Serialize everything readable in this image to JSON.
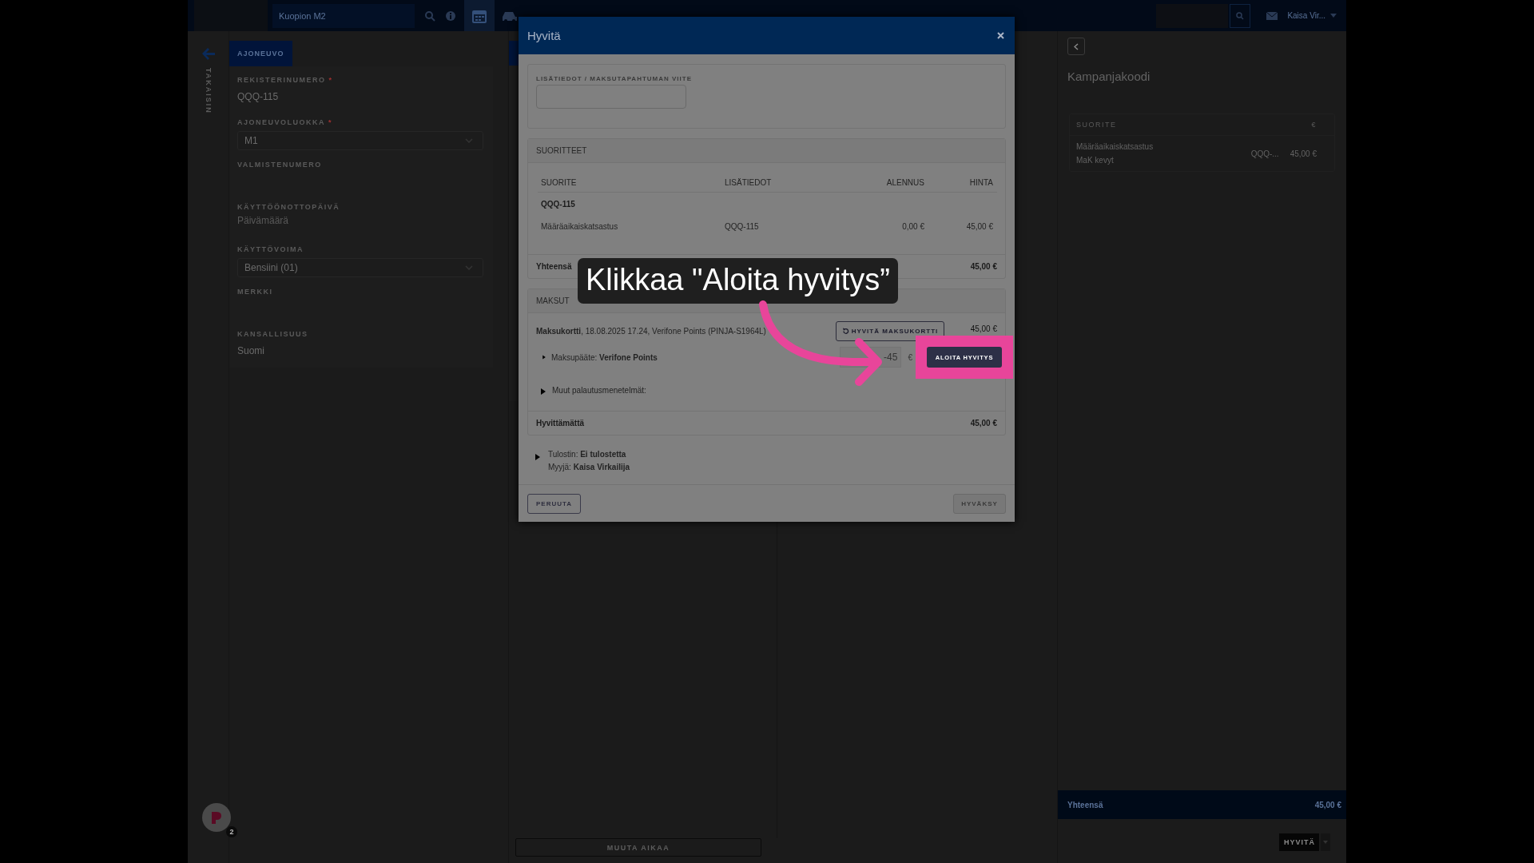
{
  "topbar": {
    "location": "Kuopion M2",
    "user": "Kaisa Vir..."
  },
  "back_label": "TAKAISIN",
  "vehicle": {
    "tab": "AJONEUVO",
    "fields": [
      {
        "label": "REKISTERINUMERO",
        "required_mark": "*",
        "kind": "text",
        "value": "QQQ-115"
      },
      {
        "label": "AJONEUVOLUOKKA",
        "required_mark": "*",
        "kind": "select",
        "value": "M1"
      },
      {
        "label": "VALMISTENUMERO",
        "kind": "text"
      },
      {
        "label": "KÄYTTÖÖNOTTOPÄIVÄ",
        "kind": "text",
        "placeholder": "Päivämäärä"
      },
      {
        "label": "KÄYTTÖVOIMA",
        "kind": "select",
        "value": "Bensiini (01)"
      },
      {
        "label": "MERKKI",
        "kind": "text"
      },
      {
        "label": "KANSALLISUUS",
        "kind": "text",
        "value": "Suomi"
      }
    ]
  },
  "change_time_button": "MUUTA AIKAA",
  "chat_badge": "2",
  "campaign": {
    "title": "Kampanjakoodi",
    "columns": [
      "SUORITE",
      "€"
    ],
    "rows": [
      {
        "name": "Määräaikaiskatsastus",
        "detail": "MaK kevyt",
        "plate": "QQQ-...",
        "price": "45,00 €"
      }
    ],
    "total": {
      "label": "Yhteensä",
      "value": "45,00 €"
    },
    "credit_button": "HYVITÄ"
  },
  "dialog": {
    "title": "Hyvitä",
    "reference_label": "LISÄTIEDOT / MAKSUTAPAHTUMAN VIITE",
    "products": {
      "heading": "SUORITTEET",
      "columns": [
        "SUORITE",
        "LISÄTIEDOT",
        "ALENNUS",
        "HINTA"
      ],
      "groups": [
        {
          "title": "QQQ-115",
          "rows": [
            [
              "Määräaikaiskatsastus",
              "QQQ-115",
              "0,00 €",
              "45,00 €"
            ]
          ]
        }
      ],
      "total": {
        "label": "Yhteensä",
        "value": "45,00 €"
      }
    },
    "payments": {
      "heading": "MAKSUT",
      "items": [
        {
          "description": "**Maksukortti**, 18.08.2025 17.24, Verifone Points (PINJA-S1964L)",
          "refund_button": "HYVITÄ MAKSUKORTTI",
          "amount": "45,00 €",
          "terminal": "Maksupääte: **Verifone Points**",
          "terminal_expanded": false,
          "refund_value": "-45",
          "currency": "€",
          "start_button": "ALOITA HYVITYS",
          "highlighted": true
        }
      ],
      "other_methods": {
        "label": "Muut palautusmenetelmät:",
        "expanded": false
      },
      "remaining": {
        "label": "Hyvittämättä",
        "value": "45,00 €"
      }
    },
    "receipt": {
      "expanded": false,
      "lines": [
        "Tulostin: **Ei tulostetta**",
        "Myyjä: **Kaisa Virkailija**"
      ]
    },
    "cancel_button": "PERUUTA",
    "approve_button": {
      "label": "HYVÄKSY",
      "disabled": true
    }
  },
  "callout": {
    "text": "Klikkaa \"Aloita hyvitys”"
  }
}
